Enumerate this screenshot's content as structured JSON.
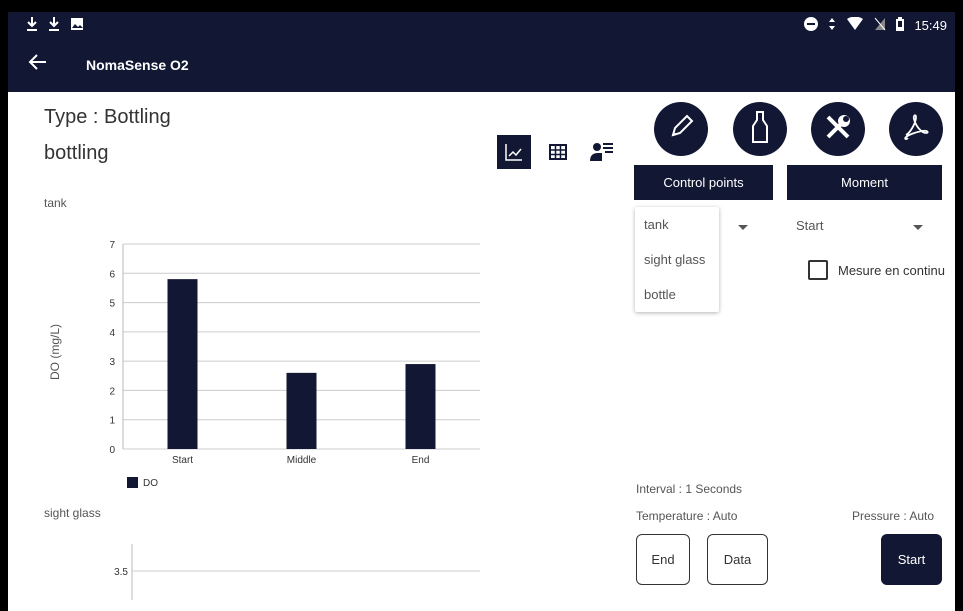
{
  "status_bar": {
    "left_icons": [
      "download-icon",
      "download-icon",
      "image-icon"
    ],
    "right_icons": [
      "do-not-disturb-icon",
      "data-arrows-icon",
      "wifi-icon",
      "no-sim-icon",
      "battery-icon"
    ],
    "time": "15:49"
  },
  "app_bar": {
    "title": "NomaSense O2"
  },
  "header": {
    "type_line": "Type : Bottling",
    "sub_line": "bottling"
  },
  "view_toggle": {
    "items": [
      "chart-icon",
      "table-icon",
      "settings-user-icon"
    ],
    "active": "chart-icon"
  },
  "charts": [
    {
      "label": "tank"
    },
    {
      "label": "sight glass"
    }
  ],
  "chart_data": [
    {
      "type": "bar",
      "title": "tank",
      "categories": [
        "Start",
        "Middle",
        "End"
      ],
      "series": [
        {
          "name": "DO",
          "values": [
            5.8,
            2.6,
            2.9
          ],
          "color": "#121733"
        }
      ],
      "ylabel": "DO (mg/L)",
      "xlabel": "",
      "ylim": [
        0,
        7
      ],
      "yticks": [
        "0",
        "1",
        "2",
        "3",
        "4",
        "5",
        "6",
        "7"
      ],
      "grid": true,
      "legend": "bottom-left"
    },
    {
      "type": "bar",
      "title": "sight glass",
      "categories": [],
      "series": [],
      "yticks": [
        "3.5"
      ],
      "grid": true
    }
  ],
  "actions": {
    "icons": [
      "pencil-icon",
      "bottle-icon",
      "tools-icon",
      "pdf-icon"
    ]
  },
  "tabs": {
    "control_points": "Control points",
    "moment": "Moment"
  },
  "dropdown_options": [
    "tank",
    "sight glass",
    "bottle"
  ],
  "moment_select": {
    "value": "Start"
  },
  "checkbox": {
    "label": "Mesure en continu",
    "checked": false
  },
  "info": {
    "interval": "Interval : 1 Seconds",
    "temperature": "Temperature : Auto",
    "pressure": "Pressure : Auto"
  },
  "buttons": {
    "end": "End",
    "data": "Data",
    "start": "Start"
  },
  "colors": {
    "primary": "#121733",
    "text": "#333333",
    "grid": "#cccccc"
  }
}
